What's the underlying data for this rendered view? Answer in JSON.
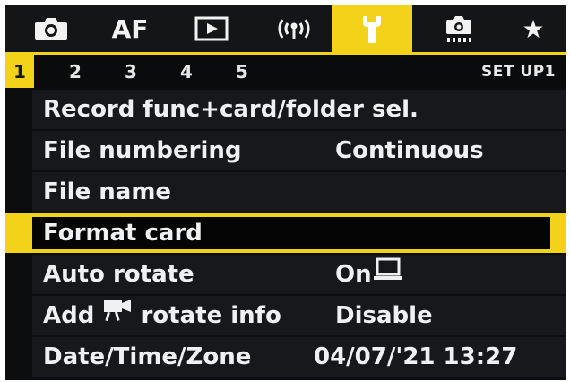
{
  "tabs": [
    {
      "icon": "camera-icon"
    },
    {
      "label": "AF"
    },
    {
      "icon": "playback-icon"
    },
    {
      "icon": "wireless-icon",
      "label": "((ψ))"
    },
    {
      "icon": "wrench-icon",
      "active": true
    },
    {
      "icon": "custom-function-camera-icon"
    },
    {
      "icon": "star-icon",
      "label": "★"
    }
  ],
  "subtabs": [
    "1",
    "2",
    "3",
    "4",
    "5"
  ],
  "active_subtab": "1",
  "page_code": "SET UP1",
  "menu": {
    "items": [
      {
        "label": "Record func+card/folder sel.",
        "value": ""
      },
      {
        "label": "File numbering",
        "value": "Continuous"
      },
      {
        "label": "File name",
        "value": ""
      },
      {
        "label": "Format card",
        "value": "",
        "selected": true
      },
      {
        "label": "Auto rotate",
        "value": "On",
        "value_icon": "computer-icon"
      },
      {
        "label_pre": "Add",
        "label_icon": "movie-camera-icon",
        "label_post": "rotate info",
        "value": "Disable"
      },
      {
        "label": "Date/Time/Zone",
        "value": "04/07/'21 13:27"
      }
    ]
  },
  "colors": {
    "accent": "#f3d21a",
    "background": "#0c0d0f",
    "row_background": "#16181b",
    "text": "#ecedef"
  }
}
